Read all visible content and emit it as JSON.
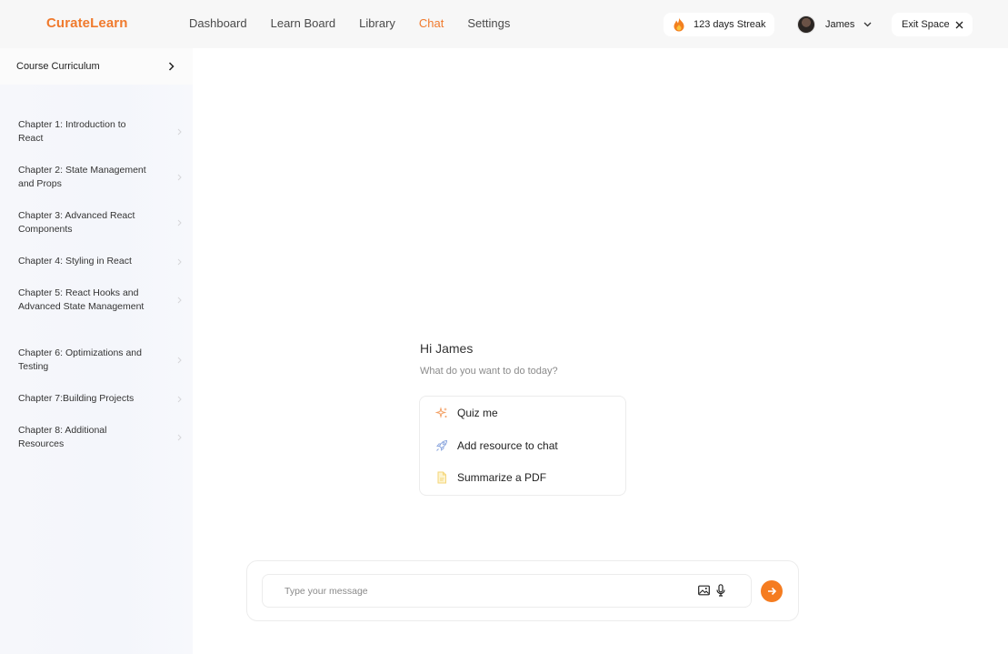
{
  "brand": {
    "name": "CurateLearn",
    "accent": "#f07a2d"
  },
  "nav": {
    "items": [
      {
        "label": "Dashboard"
      },
      {
        "label": "Learn Board"
      },
      {
        "label": "Library"
      },
      {
        "label": "Chat",
        "active": true
      },
      {
        "label": "Settings"
      }
    ]
  },
  "header": {
    "streak_label": "123 days Streak",
    "streak_icon": "flame-icon",
    "user_name": "James",
    "exit_label": "Exit Space"
  },
  "sidebar": {
    "title": "Course Curriculum",
    "chapters": [
      {
        "label": "Chapter 1: Introduction to React"
      },
      {
        "label": "Chapter  2: State Management and Props"
      },
      {
        "label": "Chapter 3: Advanced React Components"
      },
      {
        "label": "Chapter  4: Styling in React"
      },
      {
        "label": "Chapter 5: React Hooks and Advanced State Management"
      },
      {
        "label": "Chapter 6: Optimizations and Testing"
      },
      {
        "label": "Chapter  7:Building Projects"
      },
      {
        "label": "Chapter 8: Additional Resources"
      }
    ]
  },
  "main": {
    "greeting": "Hi James",
    "subtitle": "What do you want to do today?",
    "actions": [
      {
        "label": "Quiz me",
        "icon": "sparkle-icon"
      },
      {
        "label": "Add resource to chat",
        "icon": "rocket-icon"
      },
      {
        "label": "Summarize a PDF",
        "icon": "document-icon"
      }
    ]
  },
  "composer": {
    "placeholder": "Type your message",
    "value": ""
  }
}
